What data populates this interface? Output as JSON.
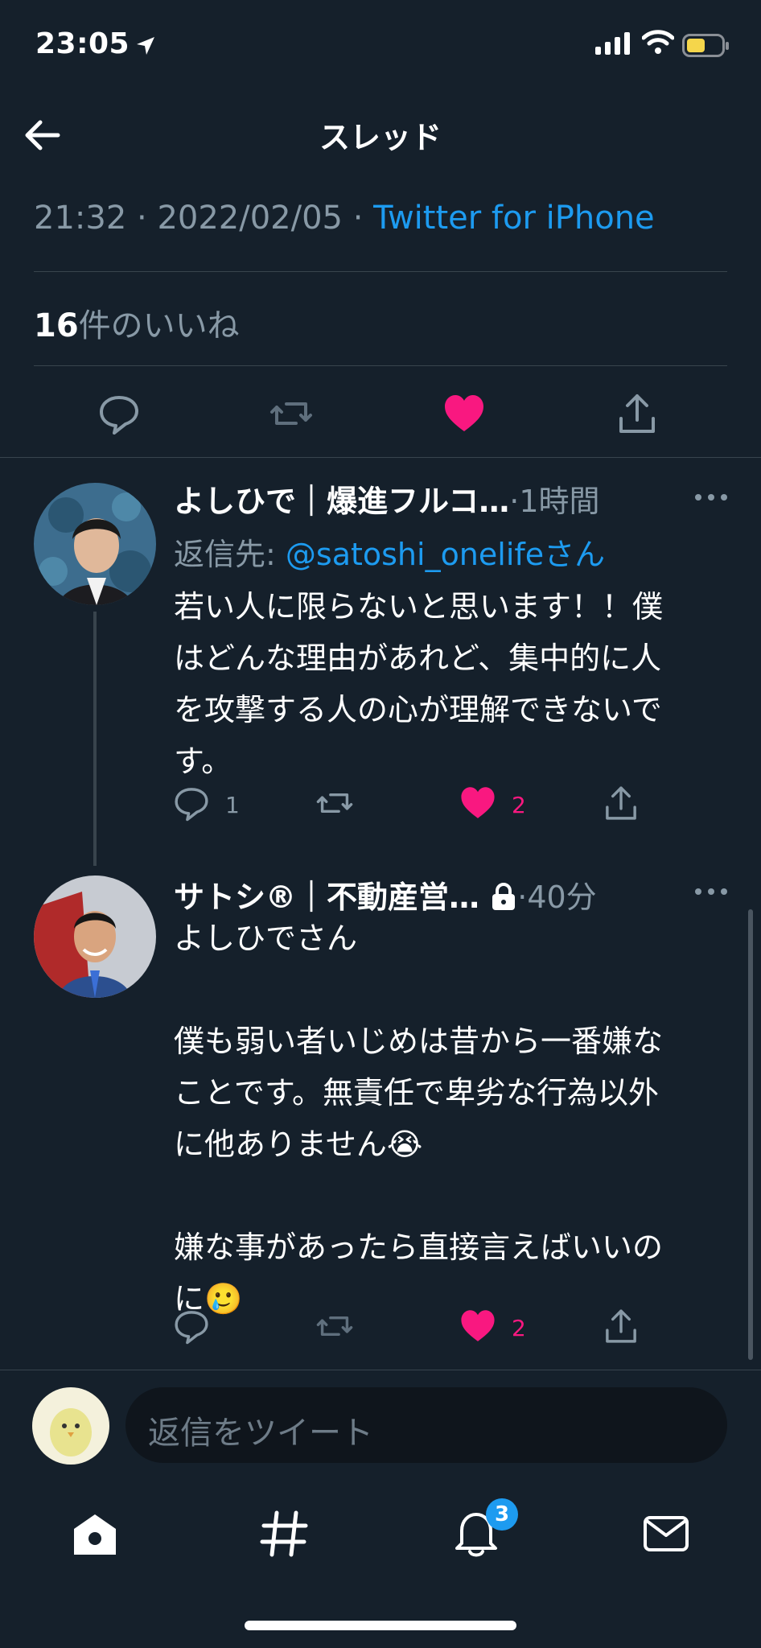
{
  "status_bar": {
    "time": "23:05"
  },
  "header": {
    "title": "スレッド"
  },
  "main_tweet": {
    "time": "21:32",
    "date": "2022/02/05",
    "source": "Twitter for iPhone",
    "likes_count": "16",
    "likes_label": "件のいいね"
  },
  "replies": [
    {
      "display_name": "よしひで｜爆進フルコ…",
      "time": "·1時間",
      "reply_to_label": "返信先: ",
      "reply_to_handle": "@satoshi_onelifeさん",
      "text": "若い人に限らないと思います！！僕\nはどんな理由があれど、集中的に人\nを攻撃する人の心が理解できないで\nす。",
      "reply_count": "1",
      "like_count": "2"
    },
    {
      "display_name": "サトシ®｜不動産営…",
      "time": "·40分",
      "text": "よしひでさん\n\n僕も弱い者いじめは昔から一番嫌な\nことです。無責任で卑劣な行為以外\nに他ありません😭\n\n嫌な事があったら直接言えばいいの\nに🥲",
      "like_count": "2"
    }
  ],
  "composer": {
    "placeholder": "返信をツイート"
  },
  "tab_bar": {
    "notifications_badge": "3"
  },
  "colors": {
    "background": "#15202b",
    "accent": "#1d9bf0",
    "like": "#f91880",
    "muted": "#8899a6"
  },
  "icons": [
    "location-arrow-icon",
    "signal-icon",
    "wifi-icon",
    "battery-icon",
    "back-arrow-icon",
    "reply-icon",
    "retweet-icon",
    "heart-icon",
    "share-icon",
    "more-icon",
    "lock-icon",
    "home-icon",
    "hashtag-icon",
    "bell-icon",
    "mail-icon"
  ]
}
